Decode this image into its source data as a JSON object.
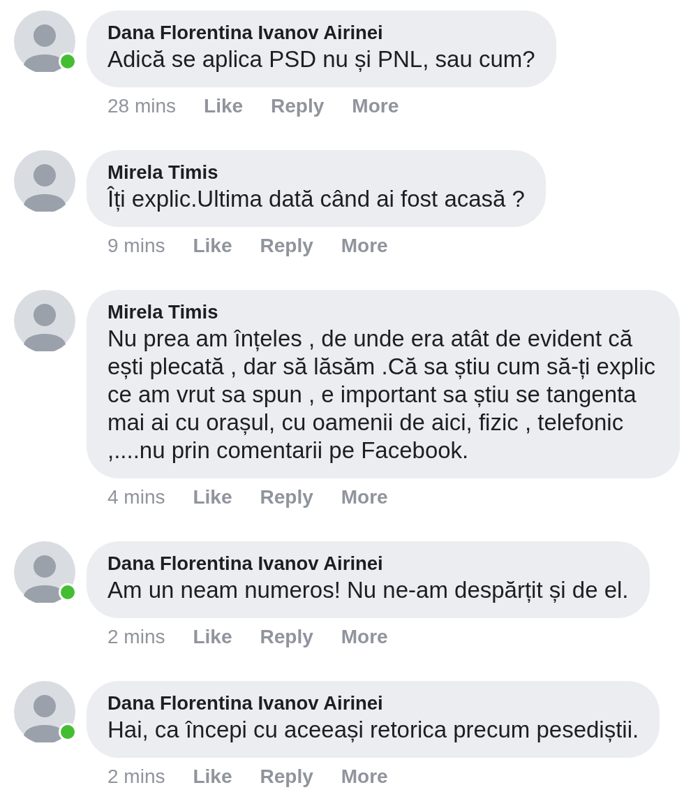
{
  "comments": [
    {
      "author": "Dana Florentina Ivanov Airinei",
      "online": true,
      "text": "Adică se aplica PSD nu și PNL, sau cum?",
      "time": "28 mins",
      "actions": [
        "Like",
        "Reply",
        "More"
      ]
    },
    {
      "author": "Mirela Timis",
      "online": false,
      "text": "Îți explic.Ultima dată când ai fost acasă ?",
      "time": "9 mins",
      "actions": [
        "Like",
        "Reply",
        "More"
      ]
    },
    {
      "author": "Mirela Timis",
      "online": false,
      "text": "Nu prea am înțeles , de unde era atât de evident că ești plecată , dar să lăsăm .Că sa știu cum să-ți explic ce am vrut sa spun , e important sa știu se tangenta mai ai cu orașul, cu oamenii de aici, fizic , telefonic ,....nu prin comentarii pe Facebook.",
      "time": "4 mins",
      "actions": [
        "Like",
        "Reply",
        "More"
      ]
    },
    {
      "author": "Dana Florentina Ivanov Airinei",
      "online": true,
      "text": "Am un neam numeros! Nu ne-am despărțit și de el.",
      "time": "2 mins",
      "actions": [
        "Like",
        "Reply",
        "More"
      ]
    },
    {
      "author": "Dana Florentina Ivanov Airinei",
      "online": true,
      "text": "Hai, ca începi cu aceeași retorica precum pesediștii.",
      "time": "2 mins",
      "actions": [
        "Like",
        "Reply",
        "More"
      ]
    }
  ]
}
